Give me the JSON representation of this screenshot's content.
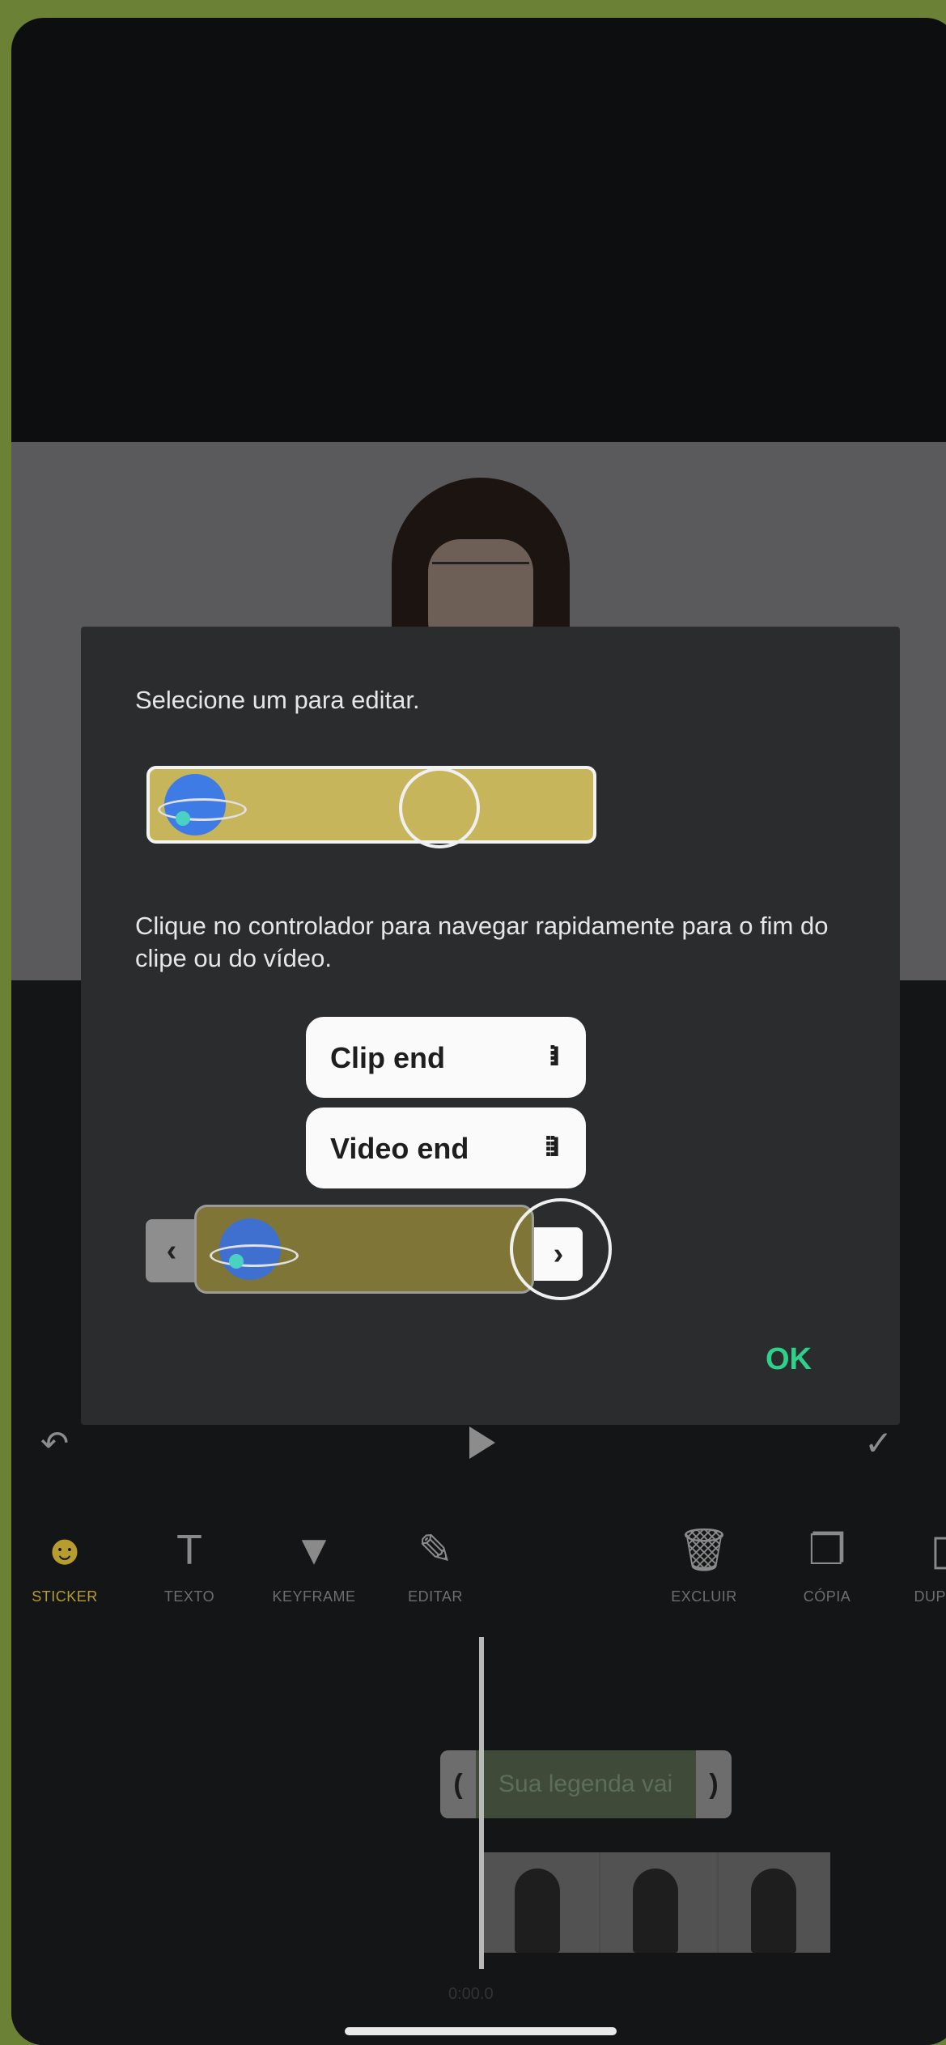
{
  "dialog": {
    "instruction_1": "Selecione um para editar.",
    "instruction_2": "Clique no controlador para navegar rapidamente para o fim do clipe ou do vídeo.",
    "clip_end_label": "Clip end",
    "clip_end_icon": "⁞I",
    "video_end_label": "Video end",
    "video_end_icon": "⁞⁞I",
    "ok_label": "OK",
    "left_handle": "‹",
    "right_handle": "›"
  },
  "controls": {
    "undo_icon": "undo-icon",
    "play_icon": "play-icon",
    "confirm_icon": "check-icon"
  },
  "tools": [
    {
      "label": "STICKER",
      "icon": "sticker-icon",
      "active": true
    },
    {
      "label": "TEXTO",
      "icon": "text-icon"
    },
    {
      "label": "KEYFRAME",
      "icon": "keyframe-icon"
    },
    {
      "label": "EDITAR",
      "icon": "pencil-icon"
    },
    {
      "label": "EXCLUIR",
      "icon": "trash-icon"
    },
    {
      "label": "CÓPIA",
      "icon": "copy-icon"
    },
    {
      "label": "DUPLIC",
      "icon": "duplicate-icon"
    }
  ],
  "timeline": {
    "subtitle_text": "Sua legenda vai",
    "time_label": "0:00.0"
  },
  "colors": {
    "accent": "#2fd08a",
    "active_tool": "#b79d2e",
    "clip_yellow": "#c6b55a",
    "background": "#6b8236"
  }
}
